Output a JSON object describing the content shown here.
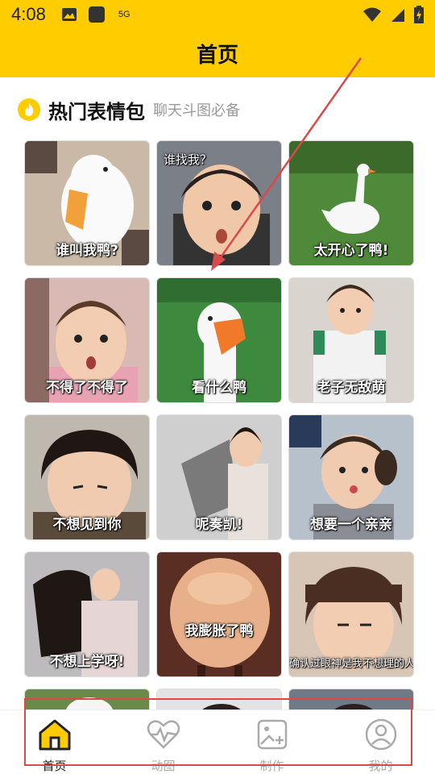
{
  "status": {
    "time": "4:08",
    "network": "5G"
  },
  "header": {
    "title": "首页"
  },
  "section": {
    "title": "热门表情包",
    "subtitle": "聊天斗图必备"
  },
  "cards": [
    {
      "caption": "谁叫我鸭?",
      "bg": "#c9b9a6"
    },
    {
      "caption": "谁找我？",
      "bg": "#7b7f88"
    },
    {
      "caption": "太开心了鸭!",
      "bg": "#4f8a3a"
    },
    {
      "caption": "不得了不得了",
      "bg": "#d8b9b3"
    },
    {
      "caption": "看什么鸭",
      "bg": "#3d8a3f"
    },
    {
      "caption": "老子无敌萌",
      "bg": "#d9d4cd"
    },
    {
      "caption": "不想见到你",
      "bg": "#bfb8ae"
    },
    {
      "caption": "呢奏凯!",
      "bg": "#cfcfcf"
    },
    {
      "caption": "想要一个亲亲",
      "bg": "#b7c1cc"
    },
    {
      "caption": "不想上学呀!",
      "bg": "#bdbbbd"
    },
    {
      "caption": "我膨胀了鸭",
      "bg": "#d9a987"
    },
    {
      "caption": "确认过眼神是我不想理的人",
      "bg": "#d7c5b6"
    }
  ],
  "tabs": [
    {
      "label": "首页",
      "icon": "home-icon",
      "active": true
    },
    {
      "label": "动图",
      "icon": "heartbeat-icon",
      "active": false
    },
    {
      "label": "制作",
      "icon": "image-add-icon",
      "active": false
    },
    {
      "label": "我的",
      "icon": "user-icon",
      "active": false
    }
  ],
  "colors": {
    "accent": "#FFCC00",
    "annotation": "#d94a4a"
  }
}
